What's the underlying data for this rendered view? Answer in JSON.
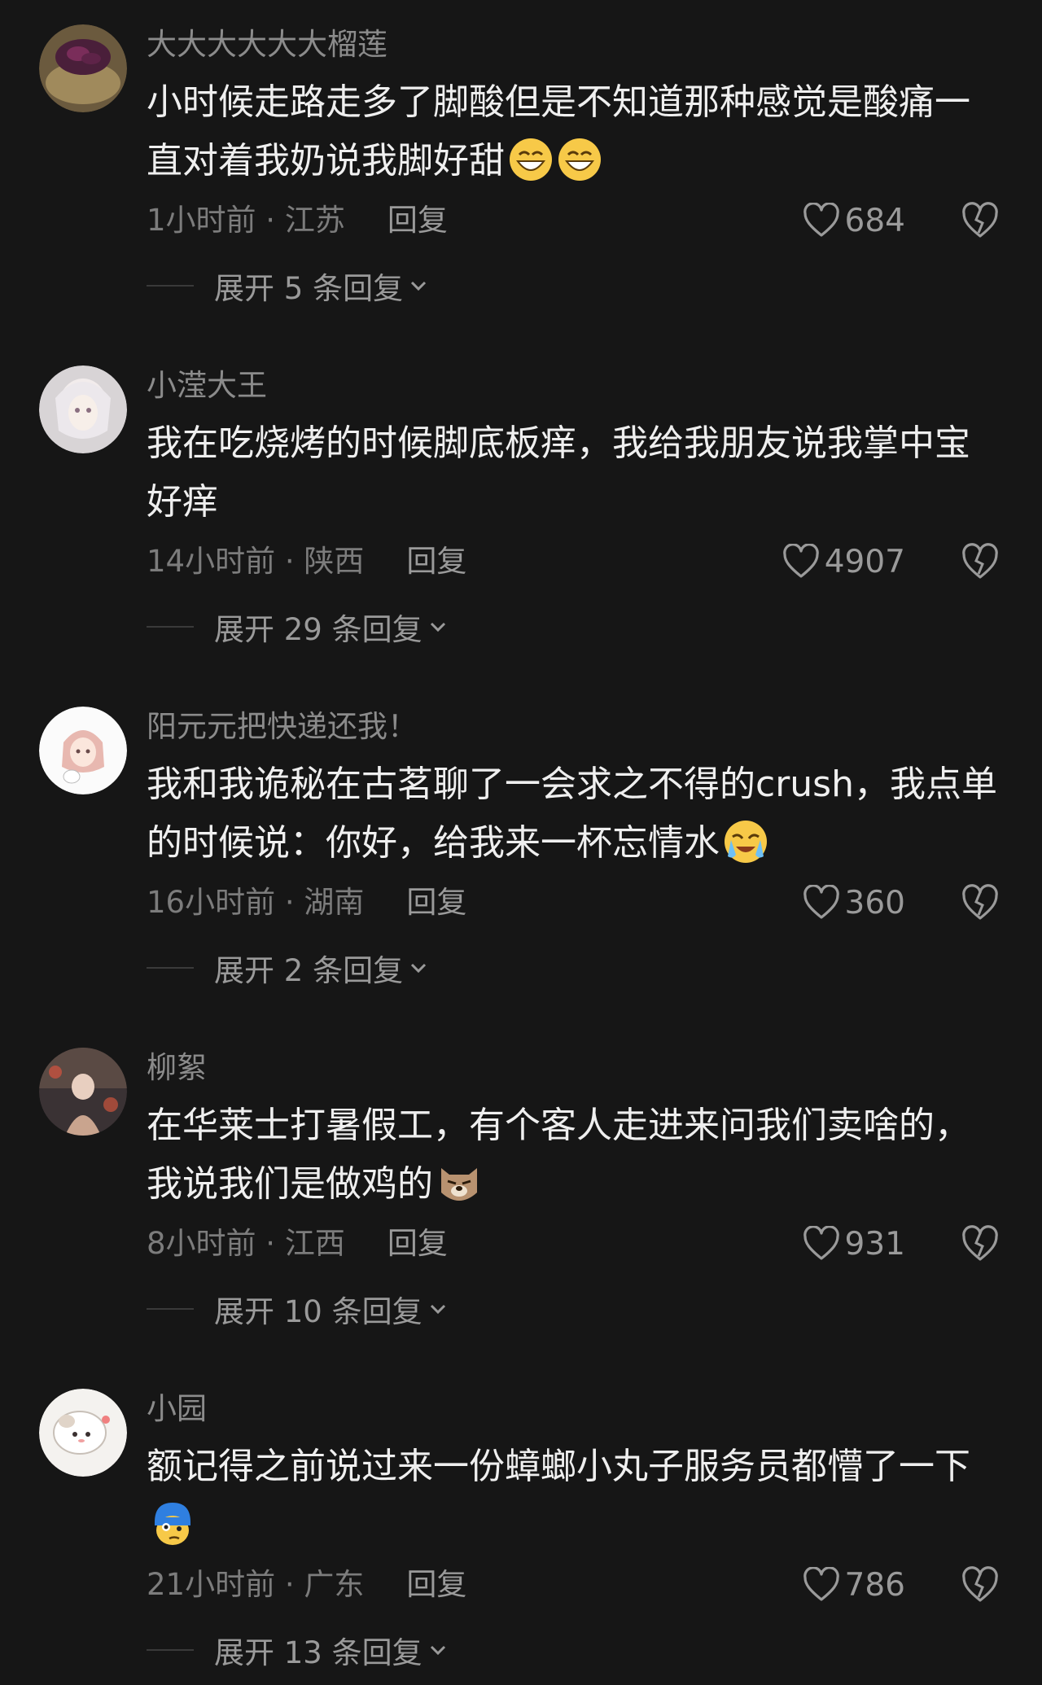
{
  "comments": [
    {
      "username": "大大大大大大榴莲",
      "text": "小时候走路走多了脚酸但是不知道那种感觉是酸痛一直对着我奶说我脚好甜",
      "emojis": [
        "grin-emoji",
        "grin-emoji"
      ],
      "time_location": "1小时前 · 江苏",
      "reply_label": "回复",
      "likes": "684",
      "expand_label": "展开 5 条回复"
    },
    {
      "username": "小滢大王",
      "text": "我在吃烧烤的时候脚底板痒，我给我朋友说我掌中宝好痒",
      "emojis": [],
      "time_location": "14小时前 · 陕西",
      "reply_label": "回复",
      "likes": "4907",
      "expand_label": "展开 29 条回复"
    },
    {
      "username": "阳元元把快递还我！",
      "text": "我和我诡秘在古茗聊了一会求之不得的crush，我点单的时候说：你好，给我来一杯忘情水",
      "emojis": [
        "crying-emoji"
      ],
      "time_location": "16小时前 · 湖南",
      "reply_label": "回复",
      "likes": "360",
      "expand_label": "展开 2 条回复"
    },
    {
      "username": "柳絮",
      "text": "在华莱士打暑假工，有个客人走进来问我们卖啥的，我说我们是做鸡的",
      "emojis": [
        "dog-face-emoji"
      ],
      "time_location": "8小时前 · 江西",
      "reply_label": "回复",
      "likes": "931",
      "expand_label": "展开 10 条回复"
    },
    {
      "username": "小园",
      "text": "额记得之前说过来一份蟑螂小丸子服务员都懵了一下",
      "emojis": [
        "confused-blue-emoji"
      ],
      "time_location": "21小时前 · 广东",
      "reply_label": "回复",
      "likes": "786",
      "expand_label": "展开 13 条回复"
    }
  ],
  "icons": {
    "like": "heart-outline-icon",
    "dislike": "broken-heart-icon",
    "expand": "chevron-down-icon"
  },
  "colors": {
    "background": "#161616",
    "text": "#efefef",
    "muted": "#8b8b8b"
  }
}
